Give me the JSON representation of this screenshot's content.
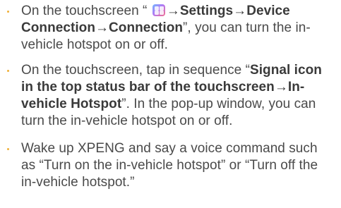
{
  "colors": {
    "text": "#4a4a4a",
    "bold_text": "#3a3a3a",
    "bullet": "#f0b13a"
  },
  "items": [
    {
      "icon": "app-launcher-icon",
      "pre_icon": "On the touchscreen “ ",
      "path": "→Settings→Device Connection→Connection",
      "post": "”, you can turn the in-vehicle hotspot on or off."
    },
    {
      "pre": "On the touchscreen, tap in sequence “",
      "path": "Signal icon in the top status bar of the touchscreen→In-vehicle Hotspot",
      "post": "”. In the pop-up window, you can turn the in-vehicle hotspot on or off."
    },
    {
      "text": "Wake up XPENG and say a voice command such as “Turn on the in-vehicle hotspot” or “Turn off the in-vehicle hotspot.”"
    }
  ]
}
